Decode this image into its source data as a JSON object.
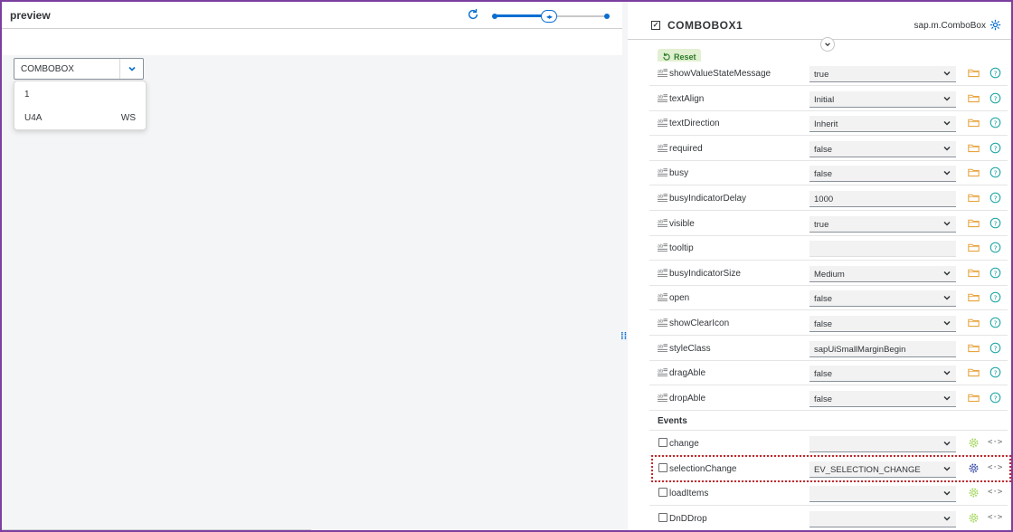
{
  "preview": {
    "title": "preview",
    "combobox": {
      "value": "COMBOBOX",
      "items": [
        {
          "text": "1",
          "additional": ""
        },
        {
          "text": "U4A",
          "additional": "WS"
        }
      ]
    }
  },
  "panel": {
    "object_name": "COMBOBOX1",
    "class_name": "sap.m.ComboBox",
    "reset_label": "Reset",
    "properties": [
      {
        "name": "showValueStateMessage",
        "value": "true",
        "type": "select"
      },
      {
        "name": "textAlign",
        "value": "Initial",
        "type": "select"
      },
      {
        "name": "textDirection",
        "value": "Inherit",
        "type": "select"
      },
      {
        "name": "required",
        "value": "false",
        "type": "select"
      },
      {
        "name": "busy",
        "value": "false",
        "type": "select"
      },
      {
        "name": "busyIndicatorDelay",
        "value": "1000",
        "type": "input"
      },
      {
        "name": "visible",
        "value": "true",
        "type": "select"
      },
      {
        "name": "tooltip",
        "value": "",
        "type": "empty"
      },
      {
        "name": "busyIndicatorSize",
        "value": "Medium",
        "type": "select"
      },
      {
        "name": "open",
        "value": "false",
        "type": "select"
      },
      {
        "name": "showClearIcon",
        "value": "false",
        "type": "select"
      },
      {
        "name": "styleClass",
        "value": "sapUiSmallMarginBegin",
        "type": "input"
      },
      {
        "name": "dragAble",
        "value": "false",
        "type": "select"
      },
      {
        "name": "dropAble",
        "value": "false",
        "type": "select"
      }
    ],
    "events_label": "Events",
    "events": [
      {
        "name": "change",
        "value": "",
        "active": false
      },
      {
        "name": "selectionChange",
        "value": "EV_SELECTION_CHANGE",
        "active": true
      },
      {
        "name": "loadItems",
        "value": "",
        "active": false
      },
      {
        "name": "DnDDrop",
        "value": "",
        "active": false
      }
    ]
  },
  "colors": {
    "accent": "#0a6ed1",
    "frame": "#7b3fa0",
    "highlight": "#c0282d",
    "folder": "#e8a33d",
    "help": "#1aa3a3",
    "gear_inactive": "#a4d65e",
    "gear_active": "#3a4ea8"
  }
}
